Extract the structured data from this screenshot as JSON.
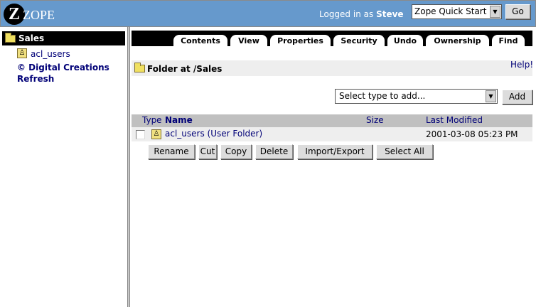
{
  "header": {
    "logo_glyph": "Z",
    "logo_text": "ZOPE",
    "logged_in_prefix": "Logged in as",
    "username": "Steve",
    "quick_start_value": "Zope Quick Start",
    "go_label": "Go",
    "background_color": "#6699cc"
  },
  "tree": {
    "root_label": "Sales",
    "items": [
      {
        "label": "acl_users",
        "icon": "user-folder-icon"
      }
    ],
    "copyright": "© Digital Creations",
    "refresh": "Refresh"
  },
  "tabs": [
    {
      "label": "Contents",
      "active": true
    },
    {
      "label": "View"
    },
    {
      "label": "Properties"
    },
    {
      "label": "Security"
    },
    {
      "label": "Undo"
    },
    {
      "label": "Ownership"
    },
    {
      "label": "Find"
    }
  ],
  "location": {
    "prefix": "Folder at",
    "path": "/Sales",
    "help": "Help!"
  },
  "add": {
    "select_value": "Select type to add...",
    "button": "Add"
  },
  "table": {
    "columns": {
      "type": "Type",
      "name": "Name",
      "size": "Size",
      "modified": "Last Modified"
    },
    "rows": [
      {
        "name": "acl_users (User Folder)",
        "size": "",
        "modified": "2001-03-08 05:23 PM",
        "checked": false,
        "icon": "user-folder-icon"
      }
    ]
  },
  "actions": {
    "rename": "Rename",
    "cut": "Cut",
    "copy": "Copy",
    "delete": "Delete",
    "import_export": "Import/Export",
    "select_all": "Select All"
  }
}
